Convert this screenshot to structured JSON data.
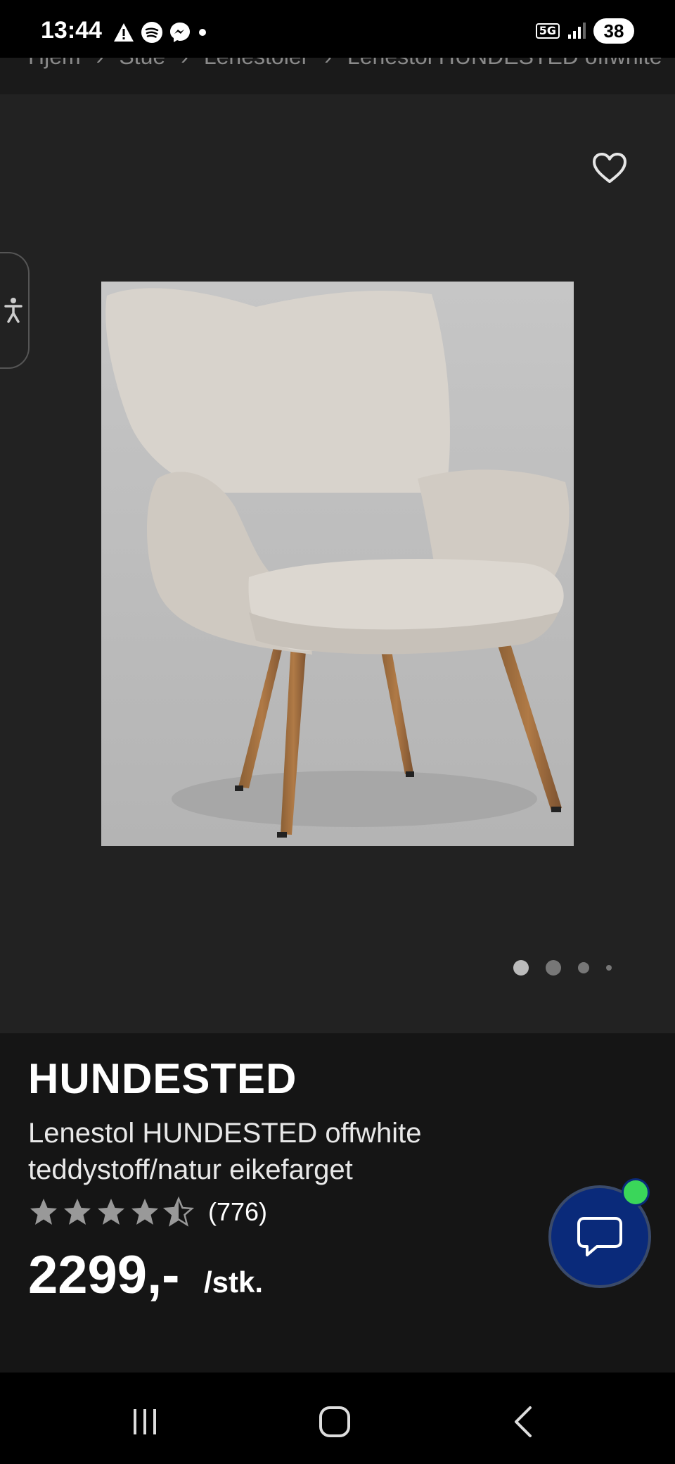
{
  "status_bar": {
    "time": "13:44",
    "network": "5G",
    "battery": "38"
  },
  "breadcrumb": {
    "items": [
      "Hjem",
      "Stue",
      "Lenestoler",
      "Lenestol HUNDESTED offwhite"
    ]
  },
  "product": {
    "brand": "HUNDESTED",
    "description": "Lenestol HUNDESTED offwhite teddystoff/natur eikefarget",
    "rating": 4.5,
    "review_count": "(776)",
    "price": "2299,-",
    "unit": "/stk.",
    "image_count": 4,
    "active_image": 1
  },
  "colors": {
    "chat_button": "#0a2a7a",
    "online_dot": "#3ad65a",
    "page_bg": "#1c1c1c"
  },
  "icons": {
    "favorite": "heart-icon",
    "accessibility": "accessibility-icon",
    "chat": "chat-bubble-icon",
    "nav_recents": "recents-icon",
    "nav_home": "home-icon",
    "nav_back": "back-icon"
  }
}
